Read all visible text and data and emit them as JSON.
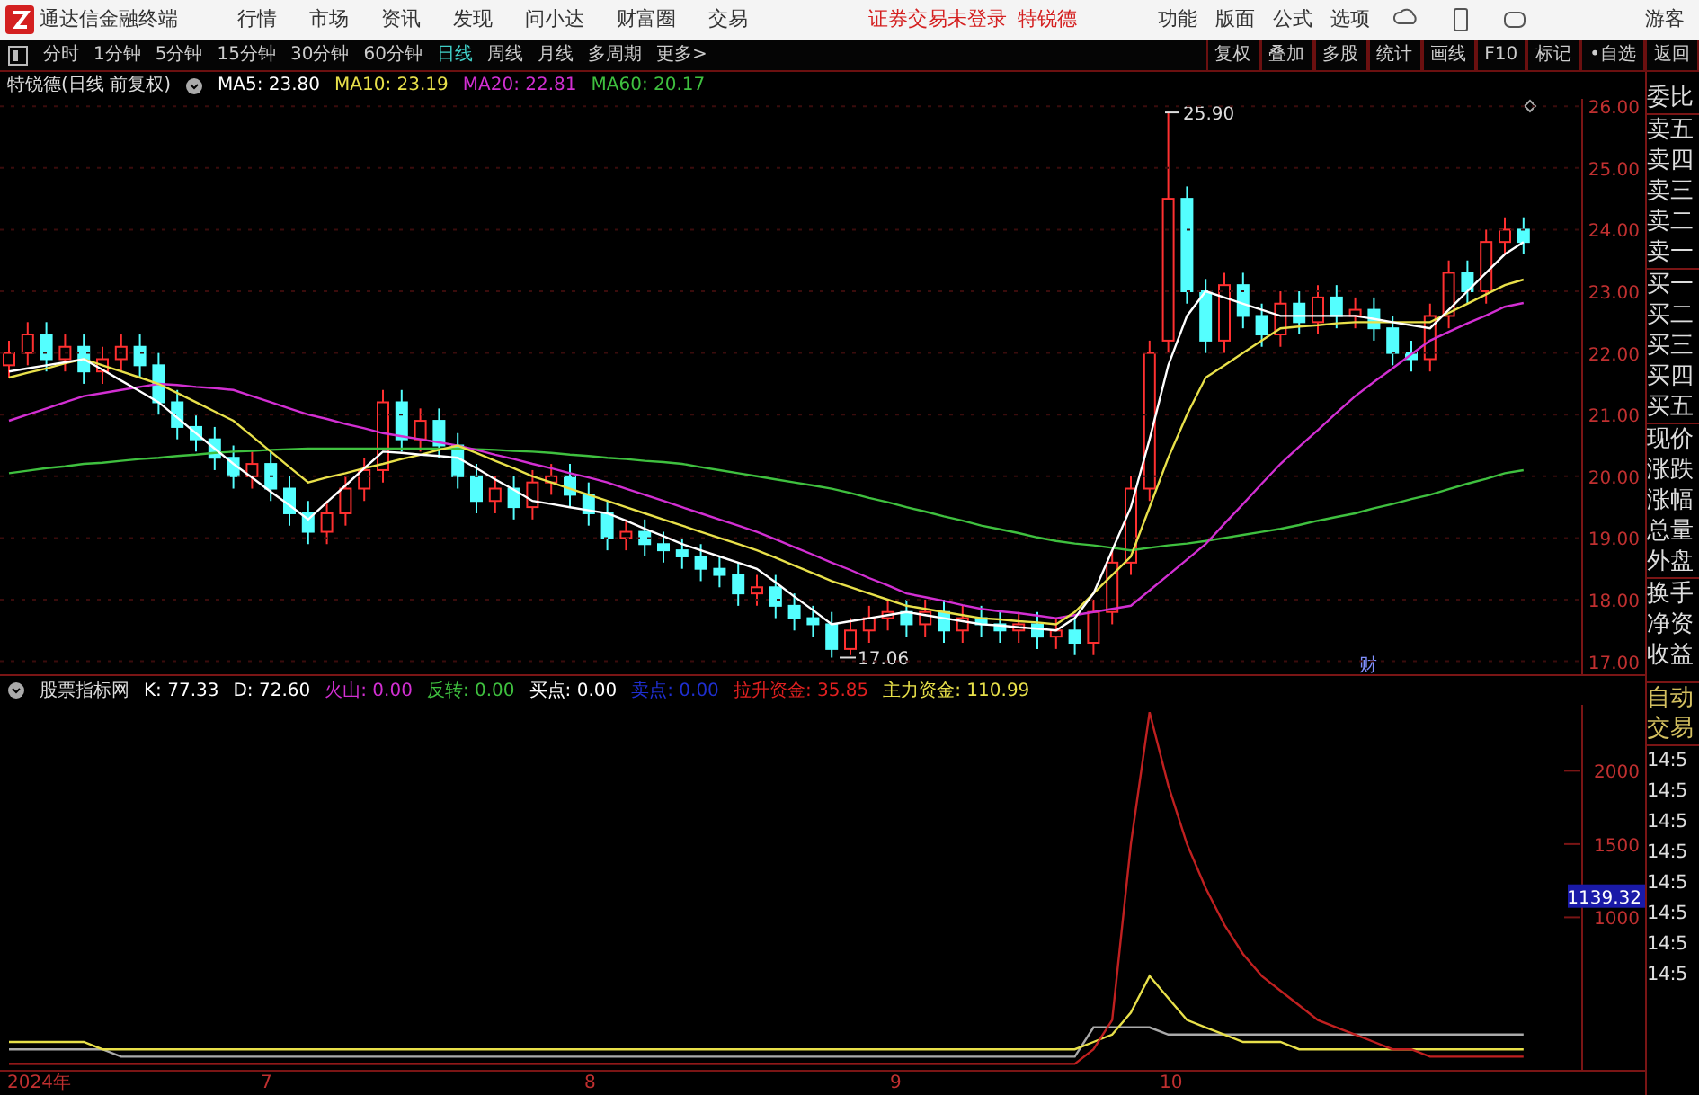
{
  "menu_bar": {
    "app_title": "通达信金融终端",
    "menus": [
      "行情",
      "市场",
      "资讯",
      "发现",
      "问小达",
      "财富圈",
      "交易"
    ],
    "notice": "证券交易未登录",
    "stock": "特锐德",
    "tools": [
      "功能",
      "版面",
      "公式",
      "选项"
    ],
    "user": "游客"
  },
  "period_bar": {
    "periods": [
      {
        "label": "分时",
        "selected": false
      },
      {
        "label": "1分钟",
        "selected": false
      },
      {
        "label": "5分钟",
        "selected": false
      },
      {
        "label": "15分钟",
        "selected": false
      },
      {
        "label": "30分钟",
        "selected": false
      },
      {
        "label": "60分钟",
        "selected": false
      },
      {
        "label": "日线",
        "selected": true
      },
      {
        "label": "周线",
        "selected": false
      },
      {
        "label": "月线",
        "selected": false
      },
      {
        "label": "多周期",
        "selected": false
      },
      {
        "label": "更多>",
        "selected": false
      }
    ],
    "actions": [
      "复权",
      "叠加",
      "多股",
      "统计",
      "画线",
      "F10",
      "标记",
      "•自选",
      "返回"
    ]
  },
  "ma_legend": {
    "title": "特锐德(日线 前复权)",
    "items": [
      {
        "label": "MA5: 23.80",
        "color": "#ffffff"
      },
      {
        "label": "MA10: 23.19",
        "color": "#e8e04a"
      },
      {
        "label": "MA20: 22.81",
        "color": "#d22fd2"
      },
      {
        "label": "MA60: 20.17",
        "color": "#3fc03f"
      }
    ]
  },
  "price_chart": {
    "high_label": "25.90",
    "low_label": "17.06",
    "event_marker": "财",
    "chart_data": {
      "type": "candlestick",
      "ohlc": [
        [
          21.8,
          22.2,
          21.6,
          22.0
        ],
        [
          22.0,
          22.5,
          21.8,
          22.3
        ],
        [
          22.3,
          22.5,
          21.7,
          21.9
        ],
        [
          21.9,
          22.3,
          21.7,
          22.1
        ],
        [
          22.1,
          22.3,
          21.5,
          21.7
        ],
        [
          21.7,
          22.1,
          21.5,
          21.9
        ],
        [
          21.9,
          22.3,
          21.7,
          22.1
        ],
        [
          22.1,
          22.3,
          21.6,
          21.8
        ],
        [
          21.8,
          22.0,
          21.0,
          21.2
        ],
        [
          21.2,
          21.4,
          20.6,
          20.8
        ],
        [
          20.8,
          21.0,
          20.4,
          20.6
        ],
        [
          20.6,
          20.8,
          20.1,
          20.3
        ],
        [
          20.3,
          20.5,
          19.8,
          20.0
        ],
        [
          20.0,
          20.4,
          19.8,
          20.2
        ],
        [
          20.2,
          20.4,
          19.6,
          19.8
        ],
        [
          19.8,
          20.0,
          19.2,
          19.4
        ],
        [
          19.4,
          19.6,
          18.9,
          19.1
        ],
        [
          19.1,
          19.6,
          18.9,
          19.4
        ],
        [
          19.4,
          20.0,
          19.2,
          19.8
        ],
        [
          19.8,
          20.3,
          19.6,
          20.1
        ],
        [
          20.1,
          21.4,
          19.9,
          21.2
        ],
        [
          21.2,
          21.4,
          20.4,
          20.6
        ],
        [
          20.6,
          21.1,
          20.4,
          20.9
        ],
        [
          20.9,
          21.1,
          20.3,
          20.5
        ],
        [
          20.5,
          20.7,
          19.8,
          20.0
        ],
        [
          20.0,
          20.2,
          19.4,
          19.6
        ],
        [
          19.6,
          20.0,
          19.4,
          19.8
        ],
        [
          19.8,
          20.0,
          19.3,
          19.5
        ],
        [
          19.5,
          20.1,
          19.3,
          19.9
        ],
        [
          19.9,
          20.2,
          19.7,
          20.0
        ],
        [
          20.0,
          20.2,
          19.5,
          19.7
        ],
        [
          19.7,
          19.9,
          19.2,
          19.4
        ],
        [
          19.4,
          19.6,
          18.8,
          19.0
        ],
        [
          19.0,
          19.3,
          18.8,
          19.1
        ],
        [
          19.1,
          19.3,
          18.7,
          18.9
        ],
        [
          18.9,
          19.1,
          18.6,
          18.8
        ],
        [
          18.8,
          19.0,
          18.5,
          18.7
        ],
        [
          18.7,
          18.9,
          18.3,
          18.5
        ],
        [
          18.5,
          18.7,
          18.2,
          18.4
        ],
        [
          18.4,
          18.6,
          17.9,
          18.1
        ],
        [
          18.1,
          18.4,
          17.9,
          18.2
        ],
        [
          18.2,
          18.4,
          17.7,
          17.9
        ],
        [
          17.9,
          18.1,
          17.5,
          17.7
        ],
        [
          17.7,
          17.9,
          17.4,
          17.6
        ],
        [
          17.6,
          17.8,
          17.06,
          17.2
        ],
        [
          17.2,
          17.7,
          17.1,
          17.5
        ],
        [
          17.5,
          17.9,
          17.3,
          17.7
        ],
        [
          17.7,
          18.0,
          17.5,
          17.8
        ],
        [
          17.8,
          18.0,
          17.4,
          17.6
        ],
        [
          17.6,
          18.0,
          17.4,
          17.8
        ],
        [
          17.8,
          18.0,
          17.3,
          17.5
        ],
        [
          17.5,
          17.9,
          17.3,
          17.7
        ],
        [
          17.7,
          17.9,
          17.4,
          17.6
        ],
        [
          17.6,
          17.8,
          17.3,
          17.5
        ],
        [
          17.5,
          17.8,
          17.3,
          17.6
        ],
        [
          17.6,
          17.8,
          17.2,
          17.4
        ],
        [
          17.4,
          17.7,
          17.2,
          17.5
        ],
        [
          17.5,
          17.7,
          17.1,
          17.3
        ],
        [
          17.3,
          18.0,
          17.1,
          17.8
        ],
        [
          17.8,
          18.8,
          17.6,
          18.6
        ],
        [
          18.6,
          20.0,
          18.4,
          19.8
        ],
        [
          19.8,
          22.2,
          19.6,
          22.0
        ],
        [
          22.2,
          25.9,
          22.0,
          24.5
        ],
        [
          24.5,
          24.7,
          22.8,
          23.0
        ],
        [
          23.0,
          23.2,
          22.0,
          22.2
        ],
        [
          22.2,
          23.3,
          22.0,
          23.1
        ],
        [
          23.1,
          23.3,
          22.4,
          22.6
        ],
        [
          22.6,
          22.8,
          22.1,
          22.3
        ],
        [
          22.3,
          23.0,
          22.1,
          22.8
        ],
        [
          22.8,
          23.0,
          22.3,
          22.5
        ],
        [
          22.5,
          23.1,
          22.3,
          22.9
        ],
        [
          22.9,
          23.1,
          22.4,
          22.6
        ],
        [
          22.6,
          22.9,
          22.4,
          22.7
        ],
        [
          22.7,
          22.9,
          22.2,
          22.4
        ],
        [
          22.4,
          22.6,
          21.8,
          22.0
        ],
        [
          22.0,
          22.2,
          21.7,
          21.9
        ],
        [
          21.9,
          22.8,
          21.7,
          22.6
        ],
        [
          22.6,
          23.5,
          22.4,
          23.3
        ],
        [
          23.3,
          23.5,
          22.8,
          23.0
        ],
        [
          23.0,
          24.0,
          22.8,
          23.8
        ],
        [
          23.8,
          24.2,
          23.6,
          24.0
        ],
        [
          24.0,
          24.2,
          23.6,
          23.8
        ]
      ]
    },
    "ma_chart": {
      "chart_data": {
        "type": "line",
        "ylim": [
          16.79,
          26.12
        ],
        "grid": true,
        "yticks": [
          {
            "value": 26,
            "label": "26.00"
          },
          {
            "value": 25,
            "label": "25.00"
          },
          {
            "value": 24,
            "label": "24.00"
          },
          {
            "value": 23,
            "label": "23.00"
          },
          {
            "value": 22,
            "label": "22.00"
          },
          {
            "value": 21,
            "label": "21.00"
          },
          {
            "value": 20,
            "label": "20.00"
          },
          {
            "value": 19,
            "label": "19.00"
          },
          {
            "value": 18,
            "label": "18.00"
          },
          {
            "value": 17,
            "label": "17.00"
          }
        ],
        "series": [
          {
            "color": "#3fc03f",
            "values": [
              20.05,
              20.09,
              20.13,
              20.16,
              20.2,
              20.22,
              20.25,
              20.28,
              20.3,
              20.33,
              20.35,
              20.38,
              20.4,
              20.41,
              20.43,
              20.44,
              20.45,
              20.45,
              20.45,
              20.45,
              20.45,
              20.45,
              20.45,
              20.45,
              20.45,
              20.44,
              20.43,
              20.41,
              20.4,
              20.38,
              20.35,
              20.33,
              20.3,
              20.28,
              20.25,
              20.23,
              20.2,
              20.15,
              20.1,
              20.05,
              20.0,
              19.95,
              19.9,
              19.85,
              19.8,
              19.73,
              19.65,
              19.58,
              19.5,
              19.43,
              19.35,
              19.28,
              19.2,
              19.14,
              19.08,
              19.01,
              18.95,
              18.91,
              18.88,
              18.84,
              18.8,
              18.84,
              18.88,
              18.91,
              18.95,
              19.0,
              19.05,
              19.1,
              19.15,
              19.21,
              19.28,
              19.34,
              19.4,
              19.48,
              19.55,
              19.63,
              19.7,
              19.79,
              19.88,
              19.96,
              20.05,
              20.1
            ]
          },
          {
            "color": "#d22fd2",
            "values": [
              20.9,
              21.0,
              21.1,
              21.2,
              21.3,
              21.35,
              21.4,
              21.45,
              21.5,
              21.48,
              21.45,
              21.43,
              21.4,
              21.3,
              21.2,
              21.1,
              21.0,
              20.93,
              20.85,
              20.78,
              20.7,
              20.65,
              20.6,
              20.55,
              20.5,
              20.43,
              20.35,
              20.28,
              20.2,
              20.13,
              20.05,
              19.98,
              19.9,
              19.8,
              19.7,
              19.6,
              19.5,
              19.4,
              19.3,
              19.2,
              19.1,
              18.98,
              18.85,
              18.73,
              18.6,
              18.48,
              18.35,
              18.23,
              18.1,
              18.04,
              17.98,
              17.91,
              17.85,
              17.81,
              17.78,
              17.74,
              17.7,
              17.75,
              17.8,
              17.85,
              17.9,
              18.15,
              18.4,
              18.65,
              18.9,
              19.23,
              19.55,
              19.88,
              20.2,
              20.48,
              20.75,
              21.03,
              21.3,
              21.53,
              21.75,
              21.98,
              22.2,
              22.34,
              22.48,
              22.61,
              22.75,
              22.81
            ]
          },
          {
            "color": "#e8e04a",
            "values": [
              21.6,
              21.68,
              21.75,
              21.83,
              21.9,
              21.8,
              21.7,
              21.6,
              21.5,
              21.35,
              21.2,
              21.05,
              20.9,
              20.65,
              20.4,
              20.15,
              19.9,
              19.98,
              20.05,
              20.13,
              20.2,
              20.28,
              20.35,
              20.43,
              20.5,
              20.38,
              20.25,
              20.13,
              20.0,
              19.9,
              19.8,
              19.7,
              19.6,
              19.5,
              19.4,
              19.3,
              19.2,
              19.1,
              19.0,
              18.9,
              18.8,
              18.68,
              18.55,
              18.43,
              18.3,
              18.2,
              18.1,
              18.0,
              17.9,
              17.85,
              17.8,
              17.75,
              17.7,
              17.68,
              17.65,
              17.63,
              17.6,
              17.8,
              18.1,
              18.4,
              18.7,
              19.5,
              20.3,
              21.0,
              21.6,
              21.8,
              22.0,
              22.2,
              22.4,
              22.43,
              22.45,
              22.48,
              22.5,
              22.5,
              22.5,
              22.5,
              22.5,
              22.65,
              22.8,
              22.95,
              23.1,
              23.19
            ]
          },
          {
            "color": "#ffffff",
            "values": [
              21.7,
              21.75,
              21.8,
              21.85,
              21.9,
              21.73,
              21.55,
              21.38,
              21.2,
              20.95,
              20.7,
              20.45,
              20.2,
              19.98,
              19.75,
              19.53,
              19.3,
              19.58,
              19.85,
              20.13,
              20.4,
              20.38,
              20.35,
              20.33,
              20.3,
              20.13,
              19.95,
              19.78,
              19.6,
              19.55,
              19.5,
              19.45,
              19.4,
              19.28,
              19.15,
              19.03,
              18.9,
              18.8,
              18.7,
              18.6,
              18.5,
              18.28,
              18.05,
              17.83,
              17.6,
              17.65,
              17.7,
              17.75,
              17.8,
              17.75,
              17.7,
              17.65,
              17.6,
              17.58,
              17.55,
              17.53,
              17.5,
              17.7,
              18.1,
              18.8,
              19.5,
              20.6,
              21.8,
              22.6,
              23.0,
              22.9,
              22.8,
              22.7,
              22.6,
              22.6,
              22.6,
              22.6,
              22.6,
              22.55,
              22.5,
              22.45,
              22.4,
              22.7,
              23.0,
              23.3,
              23.6,
              23.8
            ]
          }
        ]
      }
    }
  },
  "indicator": {
    "name": "股票指标网",
    "items": [
      {
        "label": "K: 77.33",
        "color": "#ffffff"
      },
      {
        "label": "D: 72.60",
        "color": "#ffffff"
      },
      {
        "label": "火山: 0.00",
        "color": "#d22fd2"
      },
      {
        "label": "反转: 0.00",
        "color": "#3fc03f"
      },
      {
        "label": "买点: 0.00",
        "color": "#ffffff"
      },
      {
        "label": "卖点: 0.00",
        "color": "#1f2fd0"
      },
      {
        "label": "拉升资金: 35.85",
        "color": "#e02020"
      },
      {
        "label": "主力资金: 110.99",
        "color": "#e8e04a"
      }
    ]
  },
  "indicator_chart": {
    "current_value": "1139.32",
    "chart_data": {
      "type": "line",
      "ylim": [
        -40,
        2450
      ],
      "yticks": [
        {
          "value": 2000,
          "label": "2000"
        },
        {
          "value": 1500,
          "label": "1500"
        },
        {
          "value": 1000,
          "label": "1000"
        }
      ],
      "series": [
        {
          "color": "#aaaaaa",
          "values": [
            100,
            100,
            100,
            100,
            100,
            100,
            50,
            50,
            50,
            50,
            50,
            50,
            50,
            50,
            50,
            50,
            50,
            50,
            50,
            50,
            50,
            50,
            50,
            50,
            50,
            50,
            50,
            50,
            50,
            50,
            50,
            50,
            50,
            50,
            50,
            50,
            50,
            50,
            50,
            50,
            50,
            50,
            50,
            50,
            50,
            50,
            50,
            50,
            50,
            50,
            50,
            50,
            50,
            50,
            50,
            50,
            50,
            50,
            250,
            250,
            250,
            250,
            200,
            200,
            200,
            200,
            200,
            200,
            200,
            200,
            200,
            200,
            200,
            200,
            200,
            200,
            200,
            200,
            200,
            200,
            200,
            200
          ]
        },
        {
          "color": "#e8e04a",
          "values": [
            150,
            150,
            150,
            150,
            150,
            100,
            100,
            100,
            100,
            100,
            100,
            100,
            100,
            100,
            100,
            100,
            100,
            100,
            100,
            100,
            100,
            100,
            100,
            100,
            100,
            100,
            100,
            100,
            100,
            100,
            100,
            100,
            100,
            100,
            100,
            100,
            100,
            100,
            100,
            100,
            100,
            100,
            100,
            100,
            100,
            100,
            100,
            100,
            100,
            100,
            100,
            100,
            100,
            100,
            100,
            100,
            100,
            100,
            150,
            200,
            350,
            600,
            450,
            300,
            250,
            200,
            150,
            150,
            150,
            100,
            100,
            100,
            100,
            100,
            100,
            100,
            100,
            100,
            100,
            100,
            100,
            100
          ]
        },
        {
          "color": "#c02020",
          "values": [
            0,
            0,
            0,
            0,
            0,
            0,
            0,
            0,
            0,
            0,
            0,
            0,
            0,
            0,
            0,
            0,
            0,
            0,
            0,
            0,
            0,
            0,
            0,
            0,
            0,
            0,
            0,
            0,
            0,
            0,
            0,
            0,
            0,
            0,
            0,
            0,
            0,
            0,
            0,
            0,
            0,
            0,
            0,
            0,
            0,
            0,
            0,
            0,
            0,
            0,
            0,
            0,
            0,
            0,
            0,
            0,
            0,
            0,
            100,
            300,
            1500,
            2400,
            1900,
            1500,
            1200,
            950,
            750,
            600,
            500,
            400,
            300,
            250,
            200,
            150,
            100,
            100,
            50,
            50,
            50,
            50,
            50,
            50
          ]
        }
      ]
    }
  },
  "time_axis": [
    "2024年",
    "7",
    "8",
    "9",
    "10"
  ],
  "side_panel": {
    "labels": [
      "委比",
      "卖五",
      "卖四",
      "卖三",
      "卖二",
      "卖一",
      "买一",
      "买二",
      "买三",
      "买四",
      "买五",
      "现价",
      "涨跌",
      "涨幅",
      "总量",
      "外盘",
      "换手",
      "净资",
      "收益"
    ],
    "auto_trade": [
      "自动",
      "交易"
    ],
    "times": [
      "14:5",
      "14:5",
      "14:5",
      "14:5",
      "14:5",
      "14:5",
      "14:5",
      "14:5"
    ]
  }
}
